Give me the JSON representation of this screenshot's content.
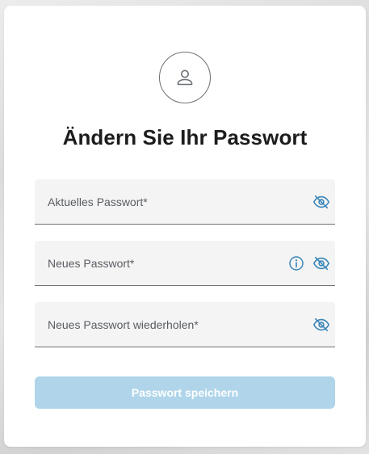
{
  "form": {
    "title": "Ändern Sie Ihr Passwort",
    "fields": [
      {
        "label": "Aktuelles Passwort*",
        "value": "",
        "has_info": false,
        "visibility_icon": "eye-off-icon"
      },
      {
        "label": "Neues Passwort*",
        "value": "",
        "has_info": true,
        "visibility_icon": "eye-off-icon"
      },
      {
        "label": "Neues Passwort wiederholen*",
        "value": "",
        "has_info": false,
        "visibility_icon": "eye-off-icon"
      }
    ],
    "save_label": "Passwort speichern",
    "save_disabled": true
  },
  "colors": {
    "accent": "#3a86b8",
    "button_disabled": "#b0d5ea",
    "field_bg": "#f4f4f5",
    "title": "#1c1c1c"
  },
  "icons": {
    "avatar": "user-icon",
    "info": "info-icon",
    "toggle": "eye-off-icon"
  }
}
